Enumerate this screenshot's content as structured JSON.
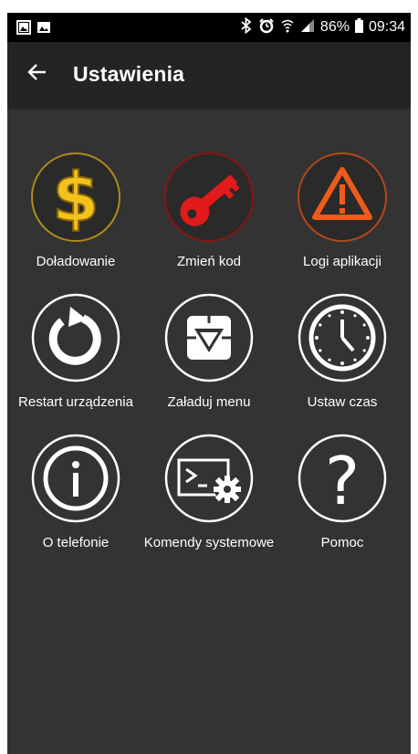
{
  "status_bar": {
    "battery": "86%",
    "time": "09:34"
  },
  "app_bar": {
    "title": "Ustawienia",
    "back_icon": "arrow-left-icon"
  },
  "colors": {
    "background": "#333333",
    "app_bar": "#242424",
    "status_bar": "#000000",
    "gold": "#e8b820",
    "red": "#e21a1a",
    "orange": "#ee5b1a",
    "white": "#ffffff"
  },
  "tiles": [
    {
      "label": "Doładowanie",
      "icon": "dollar-icon"
    },
    {
      "label": "Zmień kod",
      "icon": "key-icon"
    },
    {
      "label": "Logi aplikacji",
      "icon": "warning-icon"
    },
    {
      "label": "Restart urządzenia",
      "icon": "restart-icon"
    },
    {
      "label": "Załaduj menu",
      "icon": "load-menu-icon"
    },
    {
      "label": "Ustaw czas",
      "icon": "clock-icon"
    },
    {
      "label": "O telefonie",
      "icon": "info-icon"
    },
    {
      "label": "Komendy systemowe",
      "icon": "terminal-gear-icon"
    },
    {
      "label": "Pomoc",
      "icon": "question-icon"
    }
  ]
}
